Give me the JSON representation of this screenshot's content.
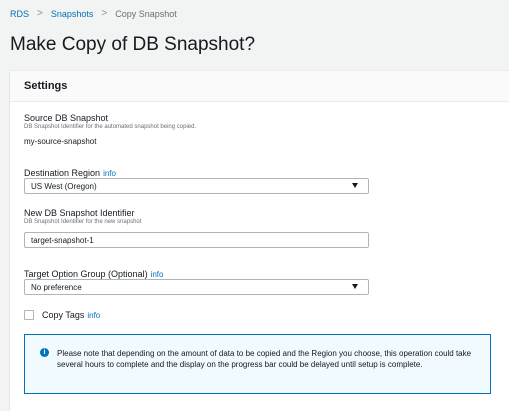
{
  "breadcrumb": {
    "items": [
      "RDS",
      "Snapshots"
    ],
    "current": "Copy Snapshot",
    "separator": ">"
  },
  "page": {
    "title": "Make Copy of DB Snapshot?"
  },
  "settings": {
    "title": "Settings",
    "source": {
      "label": "Source DB Snapshot",
      "description": "DB Snapshot Identifier for the automated snapshot being copied.",
      "value": "my-source-snapshot"
    },
    "region": {
      "label": "Destination Region",
      "info": "info",
      "selected": "US West (Oregon)"
    },
    "identifier": {
      "label": "New DB Snapshot Identifier",
      "description": "DB Snapshot Identifier for the new snapshot",
      "value": "target-snapshot-1"
    },
    "option_group": {
      "label": "Target Option Group (Optional)",
      "info": "info",
      "selected": "No preference"
    },
    "copy_tags": {
      "label": "Copy Tags",
      "info": "info",
      "checked": false
    },
    "alert": {
      "icon": "info-icon",
      "text": "Please note that depending on the amount of data to be copied and the Region you choose, this operation could take several hours to complete and the display on the progress bar could be delayed until setup is complete."
    }
  },
  "colors": {
    "link": "#0073bb",
    "background": "#f2f3f3",
    "alert_border": "#0073bb",
    "alert_background": "#f1faff"
  }
}
